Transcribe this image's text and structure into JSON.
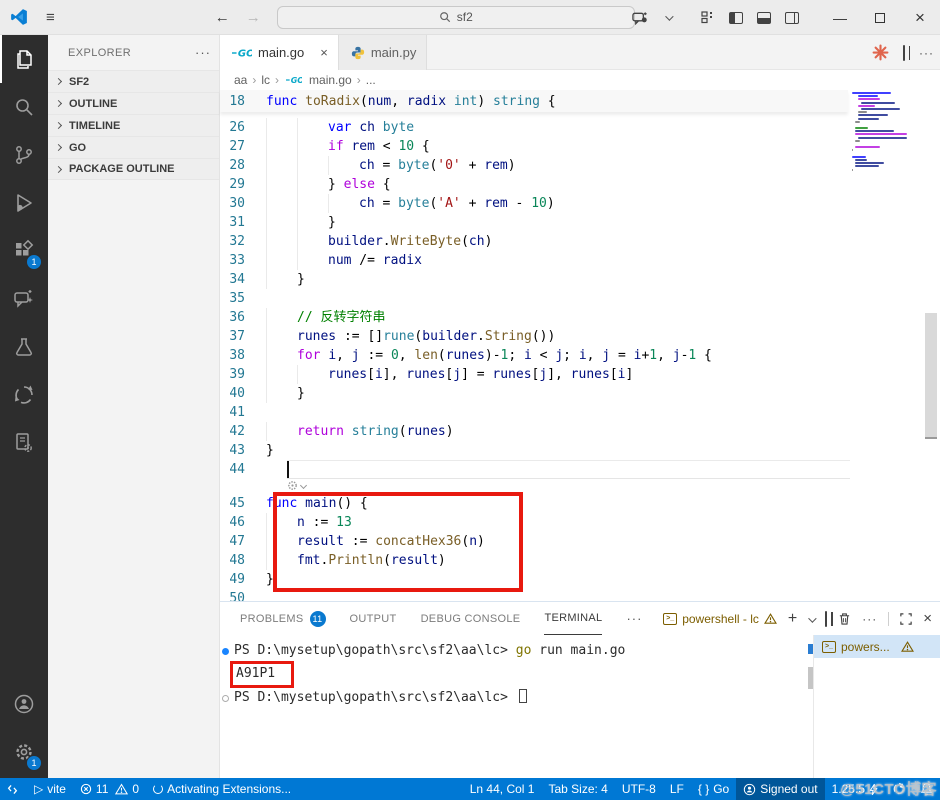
{
  "titlebar": {
    "search_value": "sf2"
  },
  "activity_bar": {
    "items": [
      {
        "name": "explorer",
        "active": true
      },
      {
        "name": "search"
      },
      {
        "name": "source-control"
      },
      {
        "name": "run-debug"
      },
      {
        "name": "extensions",
        "badge": "1"
      },
      {
        "name": "chat"
      },
      {
        "name": "testing"
      },
      {
        "name": "source-control-graph"
      },
      {
        "name": "snippets"
      }
    ],
    "bottom": [
      {
        "name": "account"
      },
      {
        "name": "settings",
        "badge": "1"
      }
    ]
  },
  "sidebar": {
    "title": "EXPLORER",
    "sections": [
      "SF2",
      "OUTLINE",
      "TIMELINE",
      "GO",
      "PACKAGE OUTLINE"
    ]
  },
  "editor": {
    "tabs": [
      {
        "label": "main.go",
        "icon": "go",
        "active": true,
        "closable": true
      },
      {
        "label": "main.py",
        "icon": "python",
        "active": false
      }
    ],
    "breadcrumbs": [
      "aa",
      "lc",
      "main.go",
      "..."
    ],
    "sticky": {
      "n": "18",
      "tok": [
        [
          "k",
          "func "
        ],
        [
          "f",
          "toRadix"
        ],
        [
          "p",
          "("
        ],
        [
          "v",
          "num"
        ],
        [
          "p",
          ", "
        ],
        [
          "v",
          "radix"
        ],
        [
          "p",
          " "
        ],
        [
          "t",
          "int"
        ],
        [
          "p",
          ") "
        ],
        [
          "t",
          "string"
        ],
        [
          "p",
          " {"
        ]
      ]
    },
    "cursor_line": 44,
    "lines": [
      {
        "n": "26",
        "g": 2,
        "tok": [
          [
            "k",
            "var "
          ],
          [
            "v",
            "ch"
          ],
          [
            "p",
            " "
          ],
          [
            "t",
            "byte"
          ]
        ]
      },
      {
        "n": "27",
        "g": 2,
        "tok": [
          [
            "c",
            "if "
          ],
          [
            "v",
            "rem"
          ],
          [
            "p",
            " < "
          ],
          [
            "n",
            "10"
          ],
          [
            "p",
            " {"
          ]
        ]
      },
      {
        "n": "28",
        "g": 3,
        "tok": [
          [
            "v",
            "ch"
          ],
          [
            "p",
            " = "
          ],
          [
            "t",
            "byte"
          ],
          [
            "p",
            "("
          ],
          [
            "s",
            "'0'"
          ],
          [
            "p",
            " + "
          ],
          [
            "v",
            "rem"
          ],
          [
            "p",
            ")"
          ]
        ]
      },
      {
        "n": "29",
        "g": 2,
        "tok": [
          [
            "p",
            "} "
          ],
          [
            "c",
            "else"
          ],
          [
            "p",
            " {"
          ]
        ]
      },
      {
        "n": "30",
        "g": 3,
        "tok": [
          [
            "v",
            "ch"
          ],
          [
            "p",
            " = "
          ],
          [
            "t",
            "byte"
          ],
          [
            "p",
            "("
          ],
          [
            "s",
            "'A'"
          ],
          [
            "p",
            " + "
          ],
          [
            "v",
            "rem"
          ],
          [
            "p",
            " - "
          ],
          [
            "n",
            "10"
          ],
          [
            "p",
            ")"
          ]
        ]
      },
      {
        "n": "31",
        "g": 2,
        "tok": [
          [
            "p",
            "}"
          ]
        ]
      },
      {
        "n": "32",
        "g": 2,
        "tok": [
          [
            "v",
            "builder"
          ],
          [
            "p",
            "."
          ],
          [
            "f",
            "WriteByte"
          ],
          [
            "p",
            "("
          ],
          [
            "v",
            "ch"
          ],
          [
            "p",
            ")"
          ]
        ]
      },
      {
        "n": "33",
        "g": 2,
        "tok": [
          [
            "v",
            "num"
          ],
          [
            "p",
            " /= "
          ],
          [
            "v",
            "radix"
          ]
        ]
      },
      {
        "n": "34",
        "g": 1,
        "tok": [
          [
            "p",
            "}"
          ]
        ]
      },
      {
        "n": "35",
        "g": 0,
        "tok": []
      },
      {
        "n": "36",
        "g": 1,
        "tok": [
          [
            "m",
            "// 反转字符串"
          ]
        ]
      },
      {
        "n": "37",
        "g": 1,
        "tok": [
          [
            "v",
            "runes"
          ],
          [
            "p",
            " := []"
          ],
          [
            "t",
            "rune"
          ],
          [
            "p",
            "("
          ],
          [
            "v",
            "builder"
          ],
          [
            "p",
            "."
          ],
          [
            "f",
            "String"
          ],
          [
            "p",
            "())"
          ]
        ]
      },
      {
        "n": "38",
        "g": 1,
        "tok": [
          [
            "c",
            "for "
          ],
          [
            "v",
            "i"
          ],
          [
            "p",
            ", "
          ],
          [
            "v",
            "j"
          ],
          [
            "p",
            " := "
          ],
          [
            "n",
            "0"
          ],
          [
            "p",
            ", "
          ],
          [
            "f",
            "len"
          ],
          [
            "p",
            "("
          ],
          [
            "v",
            "runes"
          ],
          [
            "p",
            ")-"
          ],
          [
            "n",
            "1"
          ],
          [
            "p",
            "; "
          ],
          [
            "v",
            "i"
          ],
          [
            "p",
            " < "
          ],
          [
            "v",
            "j"
          ],
          [
            "p",
            "; "
          ],
          [
            "v",
            "i"
          ],
          [
            "p",
            ", "
          ],
          [
            "v",
            "j"
          ],
          [
            "p",
            " = "
          ],
          [
            "v",
            "i"
          ],
          [
            "p",
            "+"
          ],
          [
            "n",
            "1"
          ],
          [
            "p",
            ", "
          ],
          [
            "v",
            "j"
          ],
          [
            "p",
            "-"
          ],
          [
            "n",
            "1"
          ],
          [
            "p",
            " {"
          ]
        ]
      },
      {
        "n": "39",
        "g": 2,
        "tok": [
          [
            "v",
            "runes"
          ],
          [
            "p",
            "["
          ],
          [
            "v",
            "i"
          ],
          [
            "p",
            "], "
          ],
          [
            "v",
            "runes"
          ],
          [
            "p",
            "["
          ],
          [
            "v",
            "j"
          ],
          [
            "p",
            "] = "
          ],
          [
            "v",
            "runes"
          ],
          [
            "p",
            "["
          ],
          [
            "v",
            "j"
          ],
          [
            "p",
            "], "
          ],
          [
            "v",
            "runes"
          ],
          [
            "p",
            "["
          ],
          [
            "v",
            "i"
          ],
          [
            "p",
            "]"
          ]
        ]
      },
      {
        "n": "40",
        "g": 1,
        "tok": [
          [
            "p",
            "}"
          ]
        ]
      },
      {
        "n": "41",
        "g": 0,
        "tok": []
      },
      {
        "n": "42",
        "g": 1,
        "tok": [
          [
            "c",
            "return "
          ],
          [
            "t",
            "string"
          ],
          [
            "p",
            "("
          ],
          [
            "v",
            "runes"
          ],
          [
            "p",
            ")"
          ]
        ]
      },
      {
        "n": "43",
        "g": 0,
        "tok": [
          [
            "p",
            "}"
          ]
        ]
      },
      {
        "n": "44",
        "g": 0,
        "tok": [],
        "cursor": true
      },
      {
        "n": "45",
        "g": 0,
        "tok": [
          [
            "k",
            "func "
          ],
          [
            "v",
            "main"
          ],
          [
            "p",
            "() {"
          ]
        ]
      },
      {
        "n": "46",
        "g": 1,
        "tok": [
          [
            "v",
            "n"
          ],
          [
            "p",
            " := "
          ],
          [
            "n",
            "13"
          ]
        ]
      },
      {
        "n": "47",
        "g": 1,
        "tok": [
          [
            "v",
            "result"
          ],
          [
            "p",
            " := "
          ],
          [
            "f",
            "concatHex36"
          ],
          [
            "p",
            "("
          ],
          [
            "v",
            "n"
          ],
          [
            "p",
            ")"
          ]
        ]
      },
      {
        "n": "48",
        "g": 1,
        "tok": [
          [
            "v",
            "fmt"
          ],
          [
            "p",
            "."
          ],
          [
            "f",
            "Println"
          ],
          [
            "p",
            "("
          ],
          [
            "v",
            "result"
          ],
          [
            "p",
            ")"
          ]
        ]
      },
      {
        "n": "49",
        "g": 0,
        "tok": [
          [
            "p",
            "}"
          ]
        ]
      },
      {
        "n": "50",
        "g": 0,
        "tok": []
      }
    ]
  },
  "panel": {
    "tabs": [
      {
        "label": "PROBLEMS",
        "badge": "11"
      },
      {
        "label": "OUTPUT"
      },
      {
        "label": "DEBUG CONSOLE"
      },
      {
        "label": "TERMINAL",
        "active": true
      }
    ],
    "shell_label": "powershell - lc",
    "terminal_lines": [
      {
        "marker": "filled",
        "tok": [
          [
            "pl",
            "PS D:\\mysetup\\gopath\\src\\sf2\\aa\\lc> "
          ],
          [
            "cmd",
            "go"
          ],
          [
            "pl",
            " run main.go"
          ]
        ]
      },
      {
        "boxed": true,
        "tok": [
          [
            "pl",
            "A91P1"
          ]
        ]
      },
      {
        "marker": "hollow",
        "cursor": true,
        "tok": [
          [
            "pl",
            "PS D:\\mysetup\\gopath\\src\\sf2\\aa\\lc> "
          ]
        ]
      }
    ],
    "terminal_list": [
      {
        "label": "powers...",
        "warn": true
      }
    ]
  },
  "status_bar": {
    "vite_label": "vite",
    "error_count": "11",
    "warning_count": "0",
    "activating_label": "Activating Extensions...",
    "cursor_position": "Ln 44, Col 1",
    "tab_size": "Tab Size: 4",
    "encoding": "UTF-8",
    "eol": "LF",
    "braces": "{ }",
    "language": "Go",
    "signin": "Signed out",
    "version": "1.25.5"
  },
  "watermark": "@51CTO博客",
  "colors": {
    "accent": "#0078d4",
    "annotation_red": "#e8190f",
    "badge_blue": "#0a79cf",
    "activity_bar_bg": "#2d2d2d"
  }
}
